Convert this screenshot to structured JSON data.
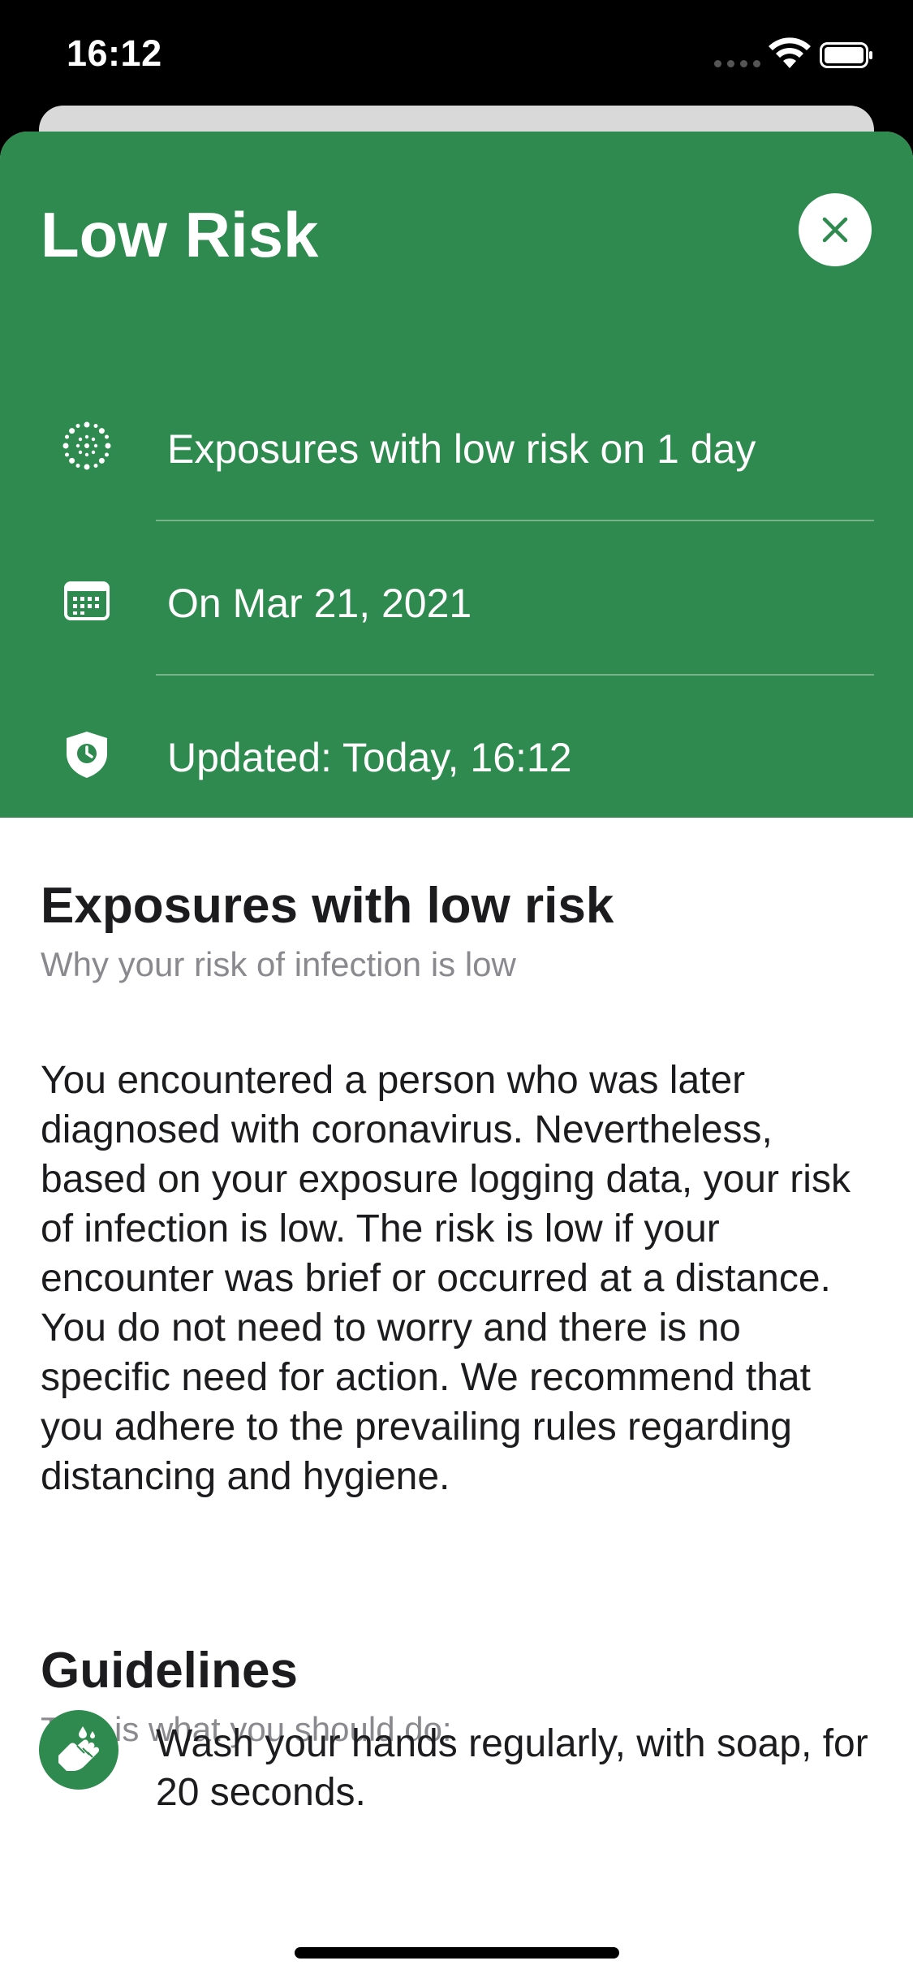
{
  "status_bar": {
    "time": "16:12"
  },
  "header": {
    "title": "Low Risk",
    "accent_color": "#2e8a4e",
    "rows": [
      {
        "icon": "exposure-virus-icon",
        "text": "Exposures with low risk on 1 day"
      },
      {
        "icon": "calendar-icon",
        "text": "On Mar 21, 2021"
      },
      {
        "icon": "shield-clock-icon",
        "text": "Updated: Today, 16:12"
      }
    ]
  },
  "exposures_section": {
    "title": "Exposures with low risk",
    "subtitle": "Why your risk of infection is low",
    "body": "You encountered a person who was later diagnosed with coronavirus. Nevertheless, based on your exposure logging data, your risk of infection is low. The risk is low if your encounter was brief or occurred at a distance. You do not need to worry and there is no specific need for action. We recommend that you adhere to the prevailing rules regarding distancing and hygiene."
  },
  "guidelines_section": {
    "title": "Guidelines",
    "subtitle": "This is what you should do:",
    "items": [
      {
        "icon": "hand-wash-icon",
        "text": "Wash your hands regularly, with soap, for 20 seconds."
      }
    ]
  }
}
